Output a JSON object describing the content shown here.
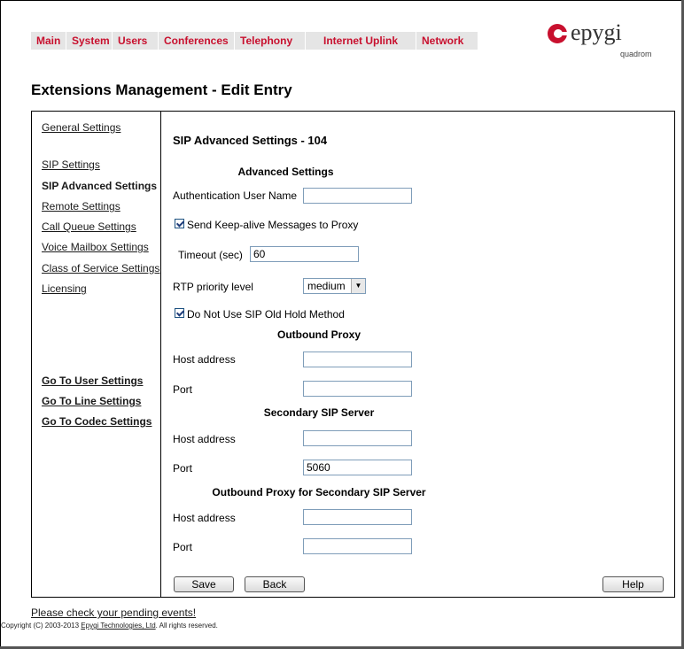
{
  "nav": {
    "tabs": [
      "Main",
      "System",
      "Users",
      "Conferences",
      "Telephony",
      "Internet Uplink",
      "Network"
    ]
  },
  "logo": {
    "name": "epygi",
    "sub": "quadrom"
  },
  "page_title": "Extensions Management - Edit Entry",
  "sidebar": {
    "items": [
      {
        "label": "General Settings",
        "current": false
      },
      {
        "label": "SIP Settings",
        "current": false
      },
      {
        "label": "SIP Advanced Settings",
        "current": true
      },
      {
        "label": "Remote Settings",
        "current": false
      },
      {
        "label": "Call Queue Settings",
        "current": false
      },
      {
        "label": "Voice Mailbox Settings",
        "current": false
      },
      {
        "label": "Class of Service Settings",
        "current": false
      },
      {
        "label": "Licensing",
        "current": false
      }
    ],
    "goto": [
      "Go To User Settings",
      "Go To Line Settings",
      "Go To Codec Settings"
    ]
  },
  "main": {
    "title": "SIP Advanced Settings - 104",
    "advanced": {
      "header": "Advanced Settings",
      "auth_user_label": "Authentication User Name",
      "auth_user_value": "",
      "keepalive_label": "Send Keep-alive Messages to Proxy",
      "keepalive_checked": true,
      "timeout_label": "Timeout (sec)",
      "timeout_value": "60",
      "rtp_label": "RTP priority level",
      "rtp_value": "medium",
      "old_hold_label": "Do Not Use SIP Old Hold Method",
      "old_hold_checked": true
    },
    "outbound_proxy": {
      "header": "Outbound Proxy",
      "host_label": "Host address",
      "host_value": "",
      "port_label": "Port",
      "port_value": ""
    },
    "secondary_sip": {
      "header": "Secondary SIP Server",
      "host_label": "Host address",
      "host_value": "",
      "port_label": "Port",
      "port_value": "5060"
    },
    "secondary_proxy": {
      "header": "Outbound Proxy for Secondary SIP Server",
      "host_label": "Host address",
      "host_value": "",
      "port_label": "Port",
      "port_value": ""
    },
    "buttons": {
      "save": "Save",
      "back": "Back",
      "help": "Help"
    }
  },
  "footer": {
    "pending_link": "Please check your pending events!",
    "copyright_pre": "Copyright (C) 2003-2013 ",
    "copyright_link": "Epygi Technologies, Ltd",
    "copyright_post": ". All rights reserved."
  }
}
